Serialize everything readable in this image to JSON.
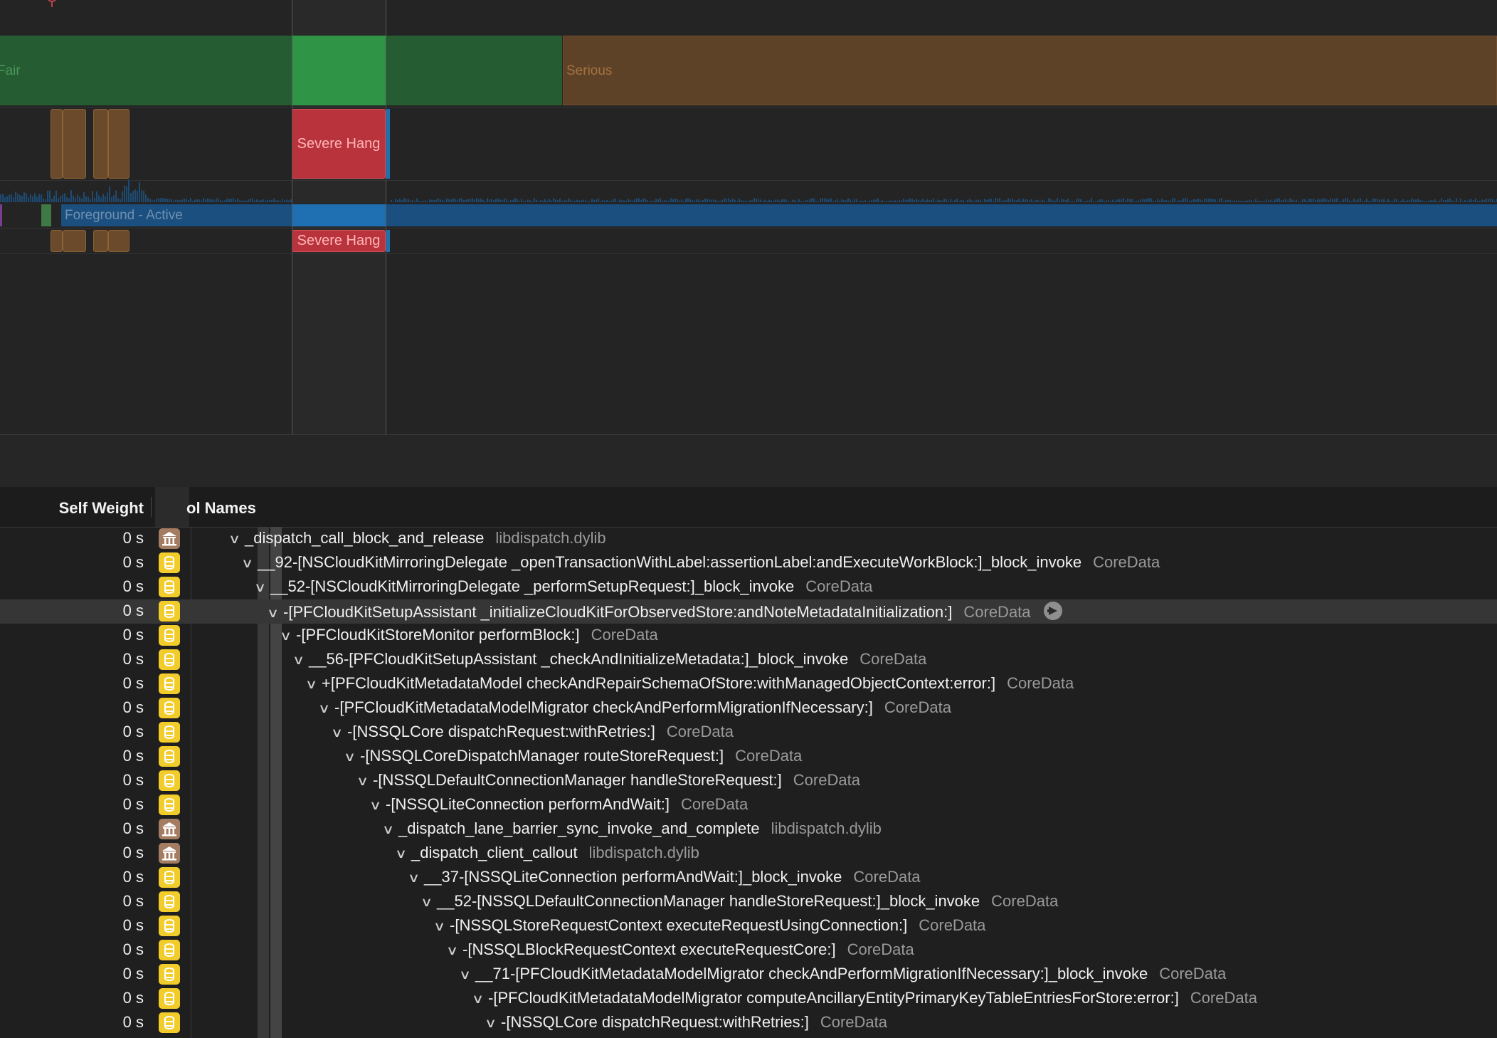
{
  "timeline": {
    "thermal_labels": {
      "fair": "Fair",
      "serious": "Serious"
    },
    "hang_label": "Severe Hang",
    "state_label": "Foreground - Active"
  },
  "calltree": {
    "headers": {
      "self_weight": "Self Weight",
      "symbol_names": "ol Names"
    },
    "rows": [
      {
        "weight": "0 s",
        "lib_kind": "system",
        "symbol": "_dispatch_call_block_and_release",
        "library": "libdispatch.dylib",
        "depth": 0
      },
      {
        "weight": "0 s",
        "lib_kind": "coredata",
        "symbol": "__92-[NSCloudKitMirroringDelegate _openTransactionWithLabel:assertionLabel:andExecuteWorkBlock:]_block_invoke",
        "library": "CoreData",
        "depth": 1
      },
      {
        "weight": "0 s",
        "lib_kind": "coredata",
        "symbol": "__52-[NSCloudKitMirroringDelegate _performSetupRequest:]_block_invoke",
        "library": "CoreData",
        "depth": 2
      },
      {
        "weight": "0 s",
        "lib_kind": "coredata",
        "symbol": "-[PFCloudKitSetupAssistant _initializeCloudKitForObservedStore:andNoteMetadataInitialization:]",
        "library": "CoreData",
        "depth": 3,
        "selected": true
      },
      {
        "weight": "0 s",
        "lib_kind": "coredata",
        "symbol": "-[PFCloudKitStoreMonitor performBlock:]",
        "library": "CoreData",
        "depth": 4
      },
      {
        "weight": "0 s",
        "lib_kind": "coredata",
        "symbol": "__56-[PFCloudKitSetupAssistant _checkAndInitializeMetadata:]_block_invoke",
        "library": "CoreData",
        "depth": 5
      },
      {
        "weight": "0 s",
        "lib_kind": "coredata",
        "symbol": "+[PFCloudKitMetadataModel checkAndRepairSchemaOfStore:withManagedObjectContext:error:]",
        "library": "CoreData",
        "depth": 6
      },
      {
        "weight": "0 s",
        "lib_kind": "coredata",
        "symbol": "-[PFCloudKitMetadataModelMigrator checkAndPerformMigrationIfNecessary:]",
        "library": "CoreData",
        "depth": 7
      },
      {
        "weight": "0 s",
        "lib_kind": "coredata",
        "symbol": "-[NSSQLCore dispatchRequest:withRetries:]",
        "library": "CoreData",
        "depth": 8
      },
      {
        "weight": "0 s",
        "lib_kind": "coredata",
        "symbol": "-[NSSQLCoreDispatchManager routeStoreRequest:]",
        "library": "CoreData",
        "depth": 9
      },
      {
        "weight": "0 s",
        "lib_kind": "coredata",
        "symbol": "-[NSSQLDefaultConnectionManager handleStoreRequest:]",
        "library": "CoreData",
        "depth": 10
      },
      {
        "weight": "0 s",
        "lib_kind": "coredata",
        "symbol": "-[NSSQLiteConnection performAndWait:]",
        "library": "CoreData",
        "depth": 11
      },
      {
        "weight": "0 s",
        "lib_kind": "system",
        "symbol": "_dispatch_lane_barrier_sync_invoke_and_complete",
        "library": "libdispatch.dylib",
        "depth": 12
      },
      {
        "weight": "0 s",
        "lib_kind": "system",
        "symbol": "_dispatch_client_callout",
        "library": "libdispatch.dylib",
        "depth": 13
      },
      {
        "weight": "0 s",
        "lib_kind": "coredata",
        "symbol": "__37-[NSSQLiteConnection performAndWait:]_block_invoke",
        "library": "CoreData",
        "depth": 14
      },
      {
        "weight": "0 s",
        "lib_kind": "coredata",
        "symbol": "__52-[NSSQLDefaultConnectionManager handleStoreRequest:]_block_invoke",
        "library": "CoreData",
        "depth": 15
      },
      {
        "weight": "0 s",
        "lib_kind": "coredata",
        "symbol": "-[NSSQLStoreRequestContext executeRequestUsingConnection:]",
        "library": "CoreData",
        "depth": 16
      },
      {
        "weight": "0 s",
        "lib_kind": "coredata",
        "symbol": "-[NSSQLBlockRequestContext executeRequestCore:]",
        "library": "CoreData",
        "depth": 17
      },
      {
        "weight": "0 s",
        "lib_kind": "coredata",
        "symbol": "__71-[PFCloudKitMetadataModelMigrator checkAndPerformMigrationIfNecessary:]_block_invoke",
        "library": "CoreData",
        "depth": 18
      },
      {
        "weight": "0 s",
        "lib_kind": "coredata",
        "symbol": "-[PFCloudKitMetadataModelMigrator computeAncillaryEntityPrimaryKeyTableEntriesForStore:error:]",
        "library": "CoreData",
        "depth": 19
      },
      {
        "weight": "0 s",
        "lib_kind": "coredata",
        "symbol": "-[NSSQLCore dispatchRequest:withRetries:]",
        "library": "CoreData",
        "depth": 20
      }
    ]
  }
}
